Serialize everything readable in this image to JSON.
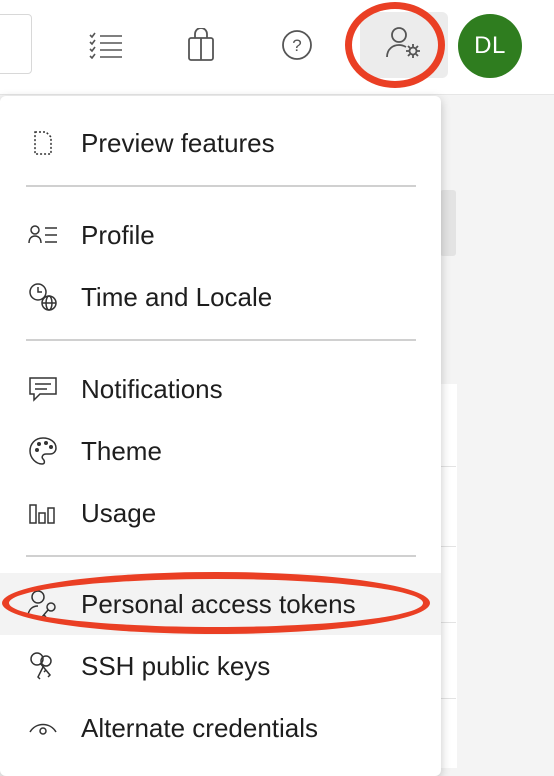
{
  "header": {
    "avatar_initials": "DL",
    "icons": [
      "list-icon",
      "shopping-bag-icon",
      "help-icon",
      "user-settings-icon"
    ]
  },
  "menu": {
    "items": [
      {
        "id": "preview-features",
        "label": "Preview features",
        "icon": "preview-icon"
      },
      {
        "id": "profile",
        "label": "Profile",
        "icon": "profile-icon"
      },
      {
        "id": "time-and-locale",
        "label": "Time and Locale",
        "icon": "globe-clock-icon"
      },
      {
        "id": "notifications",
        "label": "Notifications",
        "icon": "chat-icon"
      },
      {
        "id": "theme",
        "label": "Theme",
        "icon": "palette-icon"
      },
      {
        "id": "usage",
        "label": "Usage",
        "icon": "usage-chart-icon"
      },
      {
        "id": "personal-access-tokens",
        "label": "Personal access tokens",
        "icon": "person-key-icon",
        "selected": true
      },
      {
        "id": "ssh-public-keys",
        "label": "SSH public keys",
        "icon": "keys-icon"
      },
      {
        "id": "alternate-credentials",
        "label": "Alternate credentials",
        "icon": "eye-icon"
      }
    ]
  },
  "colors": {
    "highlight_ring": "#ea3f24",
    "avatar_bg": "#2f7d1f",
    "selected_bg": "#f3f3f3"
  }
}
